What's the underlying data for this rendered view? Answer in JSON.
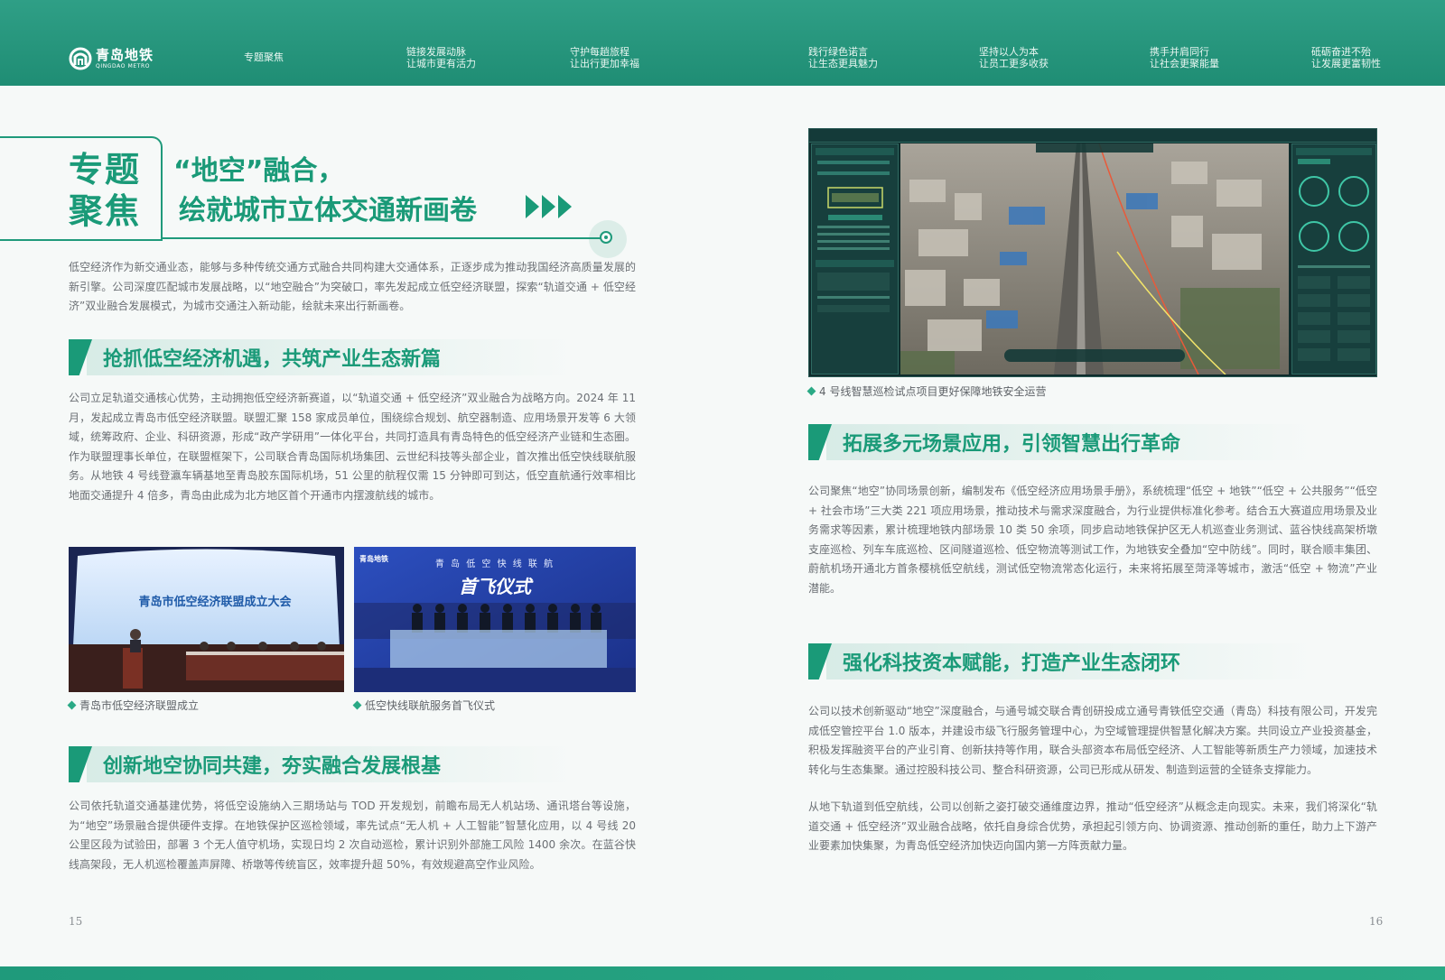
{
  "header": {
    "logo_cn": "青岛地铁",
    "logo_en": "QINGDAO METRO",
    "nav": [
      {
        "line1": "专题聚焦",
        "line2": ""
      },
      {
        "line1": "链接发展动脉",
        "line2": "让城市更有活力"
      },
      {
        "line1": "守护每趟旅程",
        "line2": "让出行更加幸福"
      },
      {
        "line1": "践行绿色诺言",
        "line2": "让生态更具魅力"
      },
      {
        "line1": "坚持以人为本",
        "line2": "让员工更多收获"
      },
      {
        "line1": "携手并肩同行",
        "line2": "让社会更聚能量"
      },
      {
        "line1": "砥砺奋进不殆",
        "line2": "让发展更富韧性"
      }
    ]
  },
  "title": {
    "tag_line1": "专题",
    "tag_line2": "聚焦",
    "headline_line1": "“地空”融合，",
    "headline_line2": "绘就城市立体交通新画卷"
  },
  "left": {
    "intro": "低空经济作为新交通业态，能够与多种传统交通方式融合共同构建大交通体系，正逐步成为推动我国经济高质量发展的新引擎。公司深度匹配城市发展战略，以“地空融合”为突破口，率先发起成立低空经济联盟，探索“轨道交通 + 低空经济”双业融合发展模式，为城市交通注入新动能，绘就未来出行新画卷。",
    "section1_title": "抢抓低空经济机遇，共筑产业生态新篇",
    "section1_body": "公司立足轨道交通核心优势，主动拥抱低空经济新赛道，以“轨道交通 + 低空经济”双业融合为战略方向。2024 年 11 月，发起成立青岛市低空经济联盟。联盟汇聚 158 家成员单位，围绕综合规划、航空器制造、应用场景开发等 6 大领域，统筹政府、企业、科研资源，形成“政产学研用”一体化平台，共同打造具有青岛特色的低空经济产业链和生态圈。作为联盟理事长单位，在联盟框架下，公司联合青岛国际机场集团、云世纪科技等头部企业，首次推出低空快线联航服务。从地铁 4 号线登瀛车辆基地至青岛胶东国际机场，51 公里的航程仅需 15 分钟即可到达，低空直航通行效率相比地面交通提升 4 倍多，青岛由此成为北方地区首个开通市内摆渡航线的城市。",
    "photo1_caption": "青岛市低空经济联盟成立",
    "photo1_banner": "青岛市低空经济联盟成立大会",
    "photo2_caption": "低空快线联航服务首飞仪式",
    "photo2_banner_top": "青 岛 低 空 快 线 联 航",
    "photo2_banner_main": "首飞仪式",
    "photo2_logo": "青岛地铁",
    "section2_title": "创新地空协同共建，夯实融合发展根基",
    "section2_body": "公司依托轨道交通基建优势，将低空设施纳入三期场站与 TOD 开发规划，前瞻布局无人机站场、通讯塔台等设施，为“地空”场景融合提供硬件支撑。在地铁保护区巡检领域，率先试点“无人机 + 人工智能”智慧化应用，以 4 号线 20 公里区段为试验田，部署 3 个无人值守机场，实现日均 2 次自动巡检，累计识别外部施工风险 1400 余次。在蓝谷快线高架段，无人机巡检覆盖声屏障、桥墩等传统盲区，效率提升超 50%，有效规避高空作业风险。",
    "page_number": "15"
  },
  "right": {
    "screenshot_caption": "4 号线智慧巡检试点项目更好保障地铁安全运营",
    "section3_title": "拓展多元场景应用，引领智慧出行革命",
    "section3_body": "公司聚焦“地空”协同场景创新，编制发布《低空经济应用场景手册》，系统梳理“低空 + 地铁”“低空 + 公共服务”“低空 + 社会市场”三大类 221 项应用场景，推动技术与需求深度融合，为行业提供标准化参考。结合五大赛道应用场景及业务需求等因素，累计梳理地铁内部场景 10 类 50 余项，同步启动地铁保护区无人机巡查业务测试、蓝谷快线高架桥墩支座巡检、列车车底巡检、区间隧道巡检、低空物流等测试工作，为地铁安全叠加“空中防线”。同时，联合顺丰集团、蔚航机场开通北方首条樱桃低空航线，测试低空物流常态化运行，未来将拓展至菏泽等城市，激活“低空 + 物流”产业潜能。",
    "section4_title": "强化科技资本赋能，打造产业生态闭环",
    "section4_body": "公司以技术创新驱动“地空”深度融合，与通号城交联合青创研投成立通号青铁低空交通（青岛）科技有限公司，开发完成低空管控平台 1.0 版本，并建设市级飞行服务管理中心，为空域管理提供智慧化解决方案。共同设立产业投资基金，积极发挥融资平台的产业引育、创新扶持等作用，联合头部资本布局低空经济、人工智能等新质生产力领域，加速技术转化与生态集聚。通过控股科技公司、整合科研资源，公司已形成从研发、制造到运营的全链条支撑能力。",
    "closing": "从地下轨道到低空航线，公司以创新之姿打破交通维度边界，推动“低空经济”从概念走向现实。未来，我们将深化“轨道交通 + 低空经济”双业融合战略，依托自身综合优势，承担起引领方向、协调资源、推动创新的重任，助力上下游产业要素加快集聚，为青岛低空经济加快迈向国内第一方阵贡献力量。",
    "page_number": "16"
  },
  "colors": {
    "brand_green": "#1a9a78",
    "header_green": "#2f9f86",
    "body_text": "#6b6f74"
  }
}
